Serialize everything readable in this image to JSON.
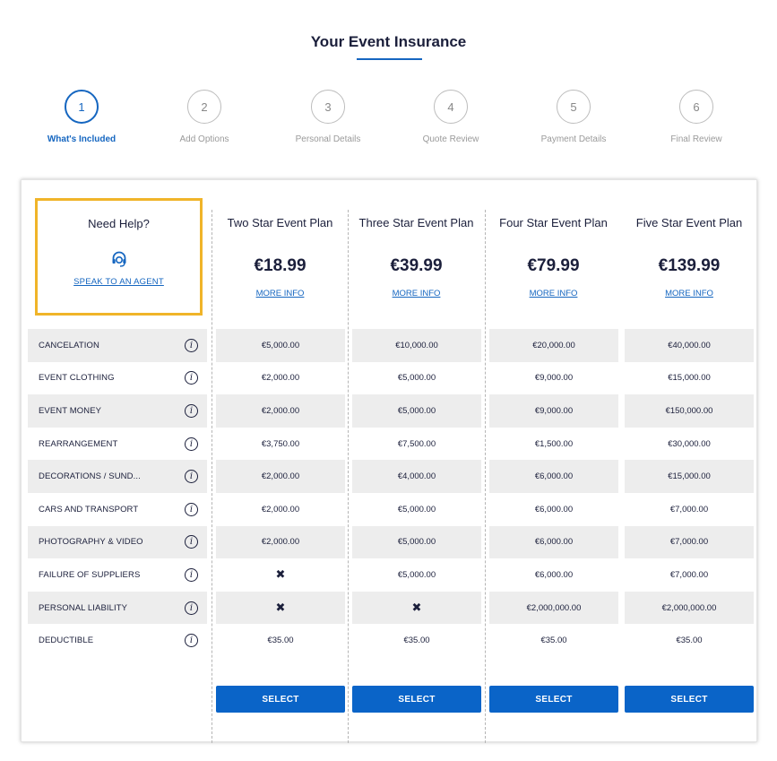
{
  "page": {
    "title": "Your Event Insurance"
  },
  "steps": [
    {
      "number": "1",
      "label": "What's Included",
      "active": true
    },
    {
      "number": "2",
      "label": "Add Options",
      "active": false
    },
    {
      "number": "3",
      "label": "Personal Details",
      "active": false
    },
    {
      "number": "4",
      "label": "Quote Review",
      "active": false
    },
    {
      "number": "5",
      "label": "Payment Details",
      "active": false
    },
    {
      "number": "6",
      "label": "Final Review",
      "active": false
    }
  ],
  "help": {
    "title": "Need Help?",
    "icon": "headset-icon",
    "link_label": "SPEAK TO AN AGENT",
    "border_color": "#f0b429"
  },
  "features": [
    {
      "label": "CANCELATION",
      "info_icon": "i"
    },
    {
      "label": "EVENT CLOTHING",
      "info_icon": "i"
    },
    {
      "label": "EVENT MONEY",
      "info_icon": "i"
    },
    {
      "label": "REARRANGEMENT",
      "info_icon": "i"
    },
    {
      "label": "DECORATIONS / SUND...",
      "info_icon": "i"
    },
    {
      "label": "CARS AND TRANSPORT",
      "info_icon": "i"
    },
    {
      "label": "PHOTOGRAPHY & VIDEO",
      "info_icon": "i"
    },
    {
      "label": "FAILURE OF SUPPLIERS",
      "info_icon": "i"
    },
    {
      "label": "PERSONAL LIABILITY",
      "info_icon": "i"
    },
    {
      "label": "DEDUCTIBLE",
      "info_icon": "i"
    }
  ],
  "plans": [
    {
      "name": "Two Star Event Plan",
      "price": "€18.99",
      "more_info": "MORE INFO",
      "select_label": "SELECT",
      "values": [
        "€5,000.00",
        "€2,000.00",
        "€2,000.00",
        "€3,750.00",
        "€2,000.00",
        "€2,000.00",
        "€2,000.00",
        "✖",
        "✖",
        "€35.00"
      ]
    },
    {
      "name": "Three Star Event Plan",
      "price": "€39.99",
      "more_info": "MORE INFO",
      "select_label": "SELECT",
      "values": [
        "€10,000.00",
        "€5,000.00",
        "€5,000.00",
        "€7,500.00",
        "€4,000.00",
        "€5,000.00",
        "€5,000.00",
        "€5,000.00",
        "✖",
        "€35.00"
      ]
    },
    {
      "name": "Four Star Event Plan",
      "price": "€79.99",
      "more_info": "MORE INFO",
      "select_label": "SELECT",
      "values": [
        "€20,000.00",
        "€9,000.00",
        "€9,000.00",
        "€1,500.00",
        "€6,000.00",
        "€6,000.00",
        "€6,000.00",
        "€6,000.00",
        "€2,000,000.00",
        "€35.00"
      ]
    },
    {
      "name": "Five Star Event Plan",
      "price": "€139.99",
      "more_info": "MORE INFO",
      "select_label": "SELECT",
      "values": [
        "€40,000.00",
        "€15,000.00",
        "€150,000.00",
        "€30,000.00",
        "€15,000.00",
        "€7,000.00",
        "€7,000.00",
        "€7,000.00",
        "€2,000,000.00",
        "€35.00"
      ]
    }
  ],
  "colors": {
    "accent": "#1566c0",
    "button": "#0a64c8",
    "row_shade": "#ededed",
    "text": "#1b1f3b"
  }
}
